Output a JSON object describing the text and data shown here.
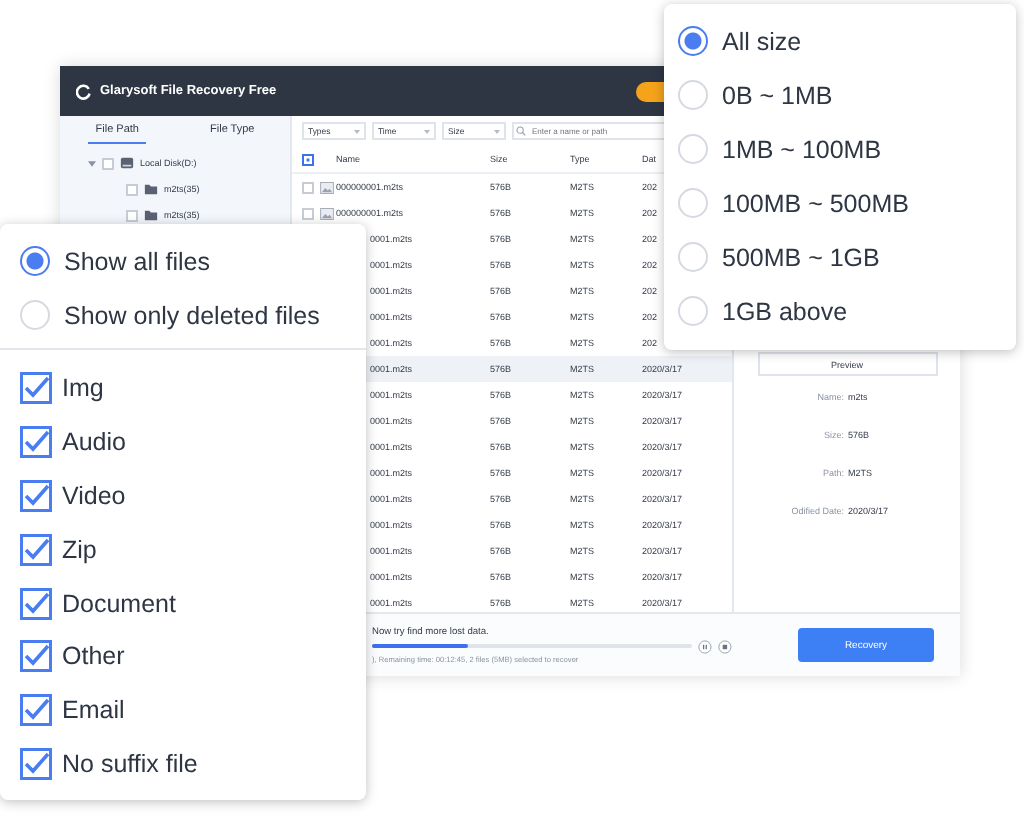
{
  "window": {
    "title": "Glarysoft File Recovery Free"
  },
  "sidebar": {
    "tabs": [
      {
        "label": "File Path",
        "selected": true
      },
      {
        "label": "File Type",
        "selected": false
      }
    ],
    "tree": [
      {
        "label": "Local Disk(D:)",
        "kind": "drive",
        "expanded": true,
        "checked": false,
        "children": [
          {
            "label": "m2ts(35)",
            "kind": "folder",
            "checked": false
          },
          {
            "label": "m2ts(35)",
            "kind": "folder",
            "checked": false
          }
        ]
      }
    ]
  },
  "toolbar": {
    "filters": [
      "Types",
      "Time",
      "Size"
    ],
    "search": {
      "placeholder": "Enter a name or path"
    }
  },
  "table": {
    "columns": [
      "Name",
      "Size",
      "Type",
      "Dat"
    ],
    "all_checked": true,
    "rows": [
      {
        "name": "000000001.m2ts",
        "size": "576B",
        "type": "M2TS",
        "date": "202",
        "checked": false,
        "selected": false
      },
      {
        "name": "000000001.m2ts",
        "size": "576B",
        "type": "M2TS",
        "date": "202",
        "checked": false,
        "selected": false
      },
      {
        "name": "0001.m2ts",
        "size": "576B",
        "type": "M2TS",
        "date": "202",
        "selected": false
      },
      {
        "name": "0001.m2ts",
        "size": "576B",
        "type": "M2TS",
        "date": "202",
        "selected": false
      },
      {
        "name": "0001.m2ts",
        "size": "576B",
        "type": "M2TS",
        "date": "202",
        "selected": false
      },
      {
        "name": "0001.m2ts",
        "size": "576B",
        "type": "M2TS",
        "date": "202",
        "selected": false
      },
      {
        "name": "0001.m2ts",
        "size": "576B",
        "type": "M2TS",
        "date": "202",
        "selected": false
      },
      {
        "name": "0001.m2ts",
        "size": "576B",
        "type": "M2TS",
        "date": "2020/3/17",
        "selected": true
      },
      {
        "name": "0001.m2ts",
        "size": "576B",
        "type": "M2TS",
        "date": "2020/3/17",
        "selected": false
      },
      {
        "name": "0001.m2ts",
        "size": "576B",
        "type": "M2TS",
        "date": "2020/3/17",
        "selected": false
      },
      {
        "name": "0001.m2ts",
        "size": "576B",
        "type": "M2TS",
        "date": "2020/3/17",
        "selected": false
      },
      {
        "name": "0001.m2ts",
        "size": "576B",
        "type": "M2TS",
        "date": "2020/3/17",
        "selected": false
      },
      {
        "name": "0001.m2ts",
        "size": "576B",
        "type": "M2TS",
        "date": "2020/3/17",
        "selected": false
      },
      {
        "name": "0001.m2ts",
        "size": "576B",
        "type": "M2TS",
        "date": "2020/3/17",
        "selected": false
      },
      {
        "name": "0001.m2ts",
        "size": "576B",
        "type": "M2TS",
        "date": "2020/3/17",
        "selected": false
      },
      {
        "name": "0001.m2ts",
        "size": "576B",
        "type": "M2TS",
        "date": "2020/3/17",
        "selected": false
      },
      {
        "name": "0001.m2ts",
        "size": "576B",
        "type": "M2TS",
        "date": "2020/3/17",
        "selected": false
      }
    ]
  },
  "preview": {
    "button": "Preview",
    "fields": [
      {
        "label": "Name:",
        "value": "m2ts"
      },
      {
        "label": "Size:",
        "value": "576B"
      },
      {
        "label": "Path:",
        "value": "M2TS"
      },
      {
        "label": "Odified Date:",
        "value": "2020/3/17"
      }
    ]
  },
  "status": {
    "message": "Now try find more lost data.",
    "level": 0.3,
    "detail": "), Remaining time: 00:12:45, 2 files (5MB) selected to recover",
    "button": "Recovery"
  },
  "view_menu": {
    "options": [
      {
        "label": "Show all files",
        "selected": true
      },
      {
        "label": "Show only deleted files",
        "selected": false
      }
    ],
    "types": [
      {
        "label": "Img",
        "checked": true
      },
      {
        "label": "Audio",
        "checked": true
      },
      {
        "label": "Video",
        "checked": true
      },
      {
        "label": "Zip",
        "checked": true
      },
      {
        "label": "Document",
        "checked": true
      },
      {
        "label": "Other",
        "checked": true
      },
      {
        "label": "Email",
        "checked": true
      },
      {
        "label": "No suffix file",
        "checked": true
      }
    ]
  },
  "size_menu": {
    "options": [
      {
        "label": "All size",
        "selected": true
      },
      {
        "label": "0B ~ 1MB",
        "selected": false
      },
      {
        "label": "1MB ~ 100MB",
        "selected": false
      },
      {
        "label": "100MB ~ 500MB",
        "selected": false
      },
      {
        "label": "500MB ~ 1GB",
        "selected": false
      },
      {
        "label": "1GB above",
        "selected": false
      }
    ]
  }
}
